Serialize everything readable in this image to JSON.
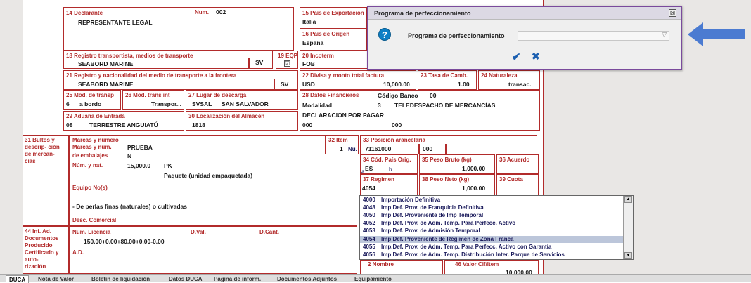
{
  "form": {
    "f14": {
      "label": "14 Declarante",
      "num_label": "Num.",
      "num": "002",
      "value": "REPRESENTANTE LEGAL"
    },
    "f15": {
      "label": "15 País de Exportación",
      "value": "Italia"
    },
    "f16": {
      "label": "16 País de Origen",
      "value": "España"
    },
    "f18": {
      "label": "18 Registro transportista, medios de transporte",
      "value": "SEABORD MARINE",
      "code": "SV"
    },
    "f19": {
      "label": "19 EQP",
      "checked": "☑"
    },
    "f20": {
      "label": "20 Incoterm",
      "value": "FOB"
    },
    "f21": {
      "label": "21 Registro y nacionalidad del medio de transporte a la frontera",
      "value": "SEABORD MARINE",
      "code": "SV"
    },
    "f22": {
      "label": "22 Divisa y monto total factura",
      "currency": "USD",
      "amount": "10,000.00"
    },
    "f23": {
      "label": "23 Tasa de Camb.",
      "value": "1.00"
    },
    "f24": {
      "label": "24 Naturaleza",
      "value": "transac."
    },
    "f25": {
      "label": "25 Mod. de transp",
      "code": "6",
      "value": "a bordo"
    },
    "f26": {
      "label": "26 Mod. trans int",
      "value": "Transpor..."
    },
    "f27": {
      "label": "27 Lugar de descarga",
      "code": "SVSAL",
      "value": "SAN SALVADOR"
    },
    "f28": {
      "label": "28 Datos Financieros",
      "bank_label": "Código Banco",
      "bank": "00",
      "mod_label": "Modalidad",
      "mod_code": "3",
      "mod_value": "TELEDESPACHO DE MERCANCÍAS",
      "payment": "DECLARACION POR PAGAR",
      "code1": "000",
      "code2": "000"
    },
    "f29": {
      "label": "29 Aduana de Entrada",
      "code": "08",
      "value": "TERRESTRE ANGUIATÚ"
    },
    "f30": {
      "label": "30 Localización del Almacén",
      "value": "1818"
    },
    "f31": {
      "side_label": "31 Bultos y descrip- ción de mercan- cías",
      "marks_label": "Marcas y número",
      "marks_num_label": "Marcas y núm.",
      "marks_num": "PRUEBA",
      "pack_label": "de embalajes",
      "pack_value": "N",
      "num_nat_label": "Núm. y nat.",
      "num_nat_value": "15,000.0",
      "num_nat_code": "PK",
      "package_desc": "Paquete (unidad empaquetada)",
      "equip_label": "Equipo No(s)",
      "desc": "- De perlas finas (naturales) o cultivadas",
      "desc_com_label": "Desc. Comercial"
    },
    "f32": {
      "label": "32 Item",
      "value": "1",
      "suffix": "Nu."
    },
    "f33": {
      "label": "33 Posición arancelaria",
      "value": "71161000",
      "code": "000"
    },
    "f34": {
      "label": "34 Cód. País Orig.",
      "value": "ES",
      "sub": "a",
      "sub2": "b"
    },
    "f35": {
      "label": "35 Peso Bruto (kg)",
      "value": "1,000.00"
    },
    "f36": {
      "label": "36 Acuerdo"
    },
    "f37": {
      "label": "37 Regimen",
      "value": "4054"
    },
    "f38": {
      "label": "38 Peso Neto (kg)",
      "value": "1,000.00"
    },
    "f39": {
      "label": "39 Cuota"
    },
    "f44": {
      "side_label": "44 Inf. Ad. Documentos Producido Certificado y auto- rización",
      "lic_label": "Núm. Licencia",
      "dval_label": "D.Val.",
      "dcant_label": "D.Cant.",
      "lic_value": "150.00+0.00+80.00+0.00-0.00",
      "ad_label": "A.D."
    },
    "f42": {
      "label": "2 Nombre"
    },
    "f46": {
      "label": "46 Valor Cif/Item",
      "value": "10,000.00"
    }
  },
  "dialog": {
    "title": "Programa de perfeccionamiento",
    "close": "⊠",
    "help_icon": "?",
    "field_label": "Programa de perfeccionamiento",
    "field_value": "",
    "caret": "▽",
    "ok": "✔",
    "cancel": "✖"
  },
  "dropdown": {
    "items": [
      {
        "code": "4000",
        "text": "Importación Definitiva"
      },
      {
        "code": "4048",
        "text": "Imp Def. Prov. de Franquicia Definitiva"
      },
      {
        "code": "4050",
        "text": "Imp Def. Proveniente de Imp Temporal"
      },
      {
        "code": "4052",
        "text": "Imp Def. Prov. de Adm. Temp. Para Perfecc. Activo"
      },
      {
        "code": "4053",
        "text": "Imp Def. Prov. de Admisión Temporal"
      },
      {
        "code": "4054",
        "text": "Imp Def. Proveniente de Régimen de Zona Franca"
      },
      {
        "code": "4055",
        "text": "Imp.Def. Prov. de Adm. Temp. Para Perfecc. Activo con Garantía"
      },
      {
        "code": "4056",
        "text": "Imp Def. Prov. de Adm. Temp. Distribución Inter. Parque de Servicios"
      }
    ],
    "selected_index": 5
  },
  "tabs": [
    "DUCA",
    "Nota de Valor",
    "Boletín de liquidación",
    "Datos DUCA",
    "Página de inform.",
    "Documentos Adjuntos",
    "Equipamiento"
  ],
  "colors": {
    "border": "#b22b2b",
    "arrow": "#4b7bd1",
    "selected": "#bcc6da"
  }
}
